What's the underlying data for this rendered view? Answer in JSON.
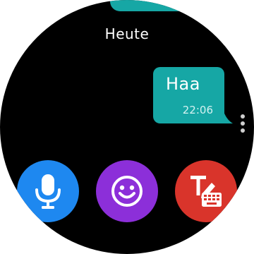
{
  "screen": {
    "date_label": "Heute"
  },
  "message": {
    "text": "Haa",
    "time": "22:06"
  },
  "actions": {
    "voice_icon": "microphone-icon",
    "emoji_icon": "smiley-icon",
    "keyboard_icon": "handwriting-keyboard-icon"
  },
  "colors": {
    "bubble": "#16a7a5",
    "voice": "#1e88f0",
    "emoji": "#8c2fd9",
    "keyboard": "#d9342b"
  }
}
